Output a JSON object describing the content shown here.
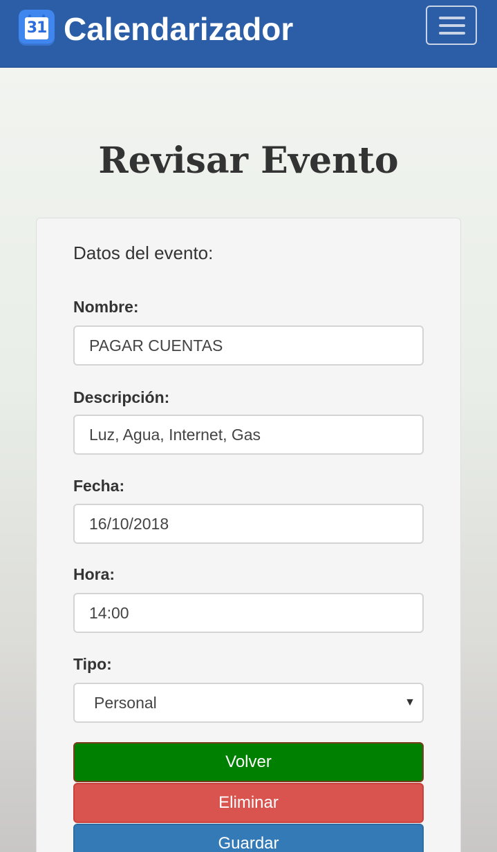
{
  "navbar": {
    "brand_icon_text": "31",
    "brand_title": "Calendarizador",
    "brand_color": "#2b5ea6"
  },
  "page": {
    "title": "Revisar Evento"
  },
  "form": {
    "section_title": "Datos del evento:",
    "nombre_label": "Nombre:",
    "nombre_value": "PAGAR CUENTAS",
    "descripcion_label": "Descripción:",
    "descripcion_value": "Luz, Agua, Internet, Gas",
    "fecha_label": "Fecha:",
    "fecha_value": "16/10/2018",
    "hora_label": "Hora:",
    "hora_value": "14:00",
    "tipo_label": "Tipo:",
    "tipo_selected": "Personal"
  },
  "buttons": {
    "volver": "Volver",
    "eliminar": "Eliminar",
    "guardar": "Guardar"
  },
  "icons": {
    "brand": "calendar-icon",
    "menu": "hamburger-menu-icon",
    "select_caret": "caret-down-icon"
  },
  "colors": {
    "volver": "#008000",
    "eliminar": "#d9534f",
    "guardar": "#337ab7"
  }
}
